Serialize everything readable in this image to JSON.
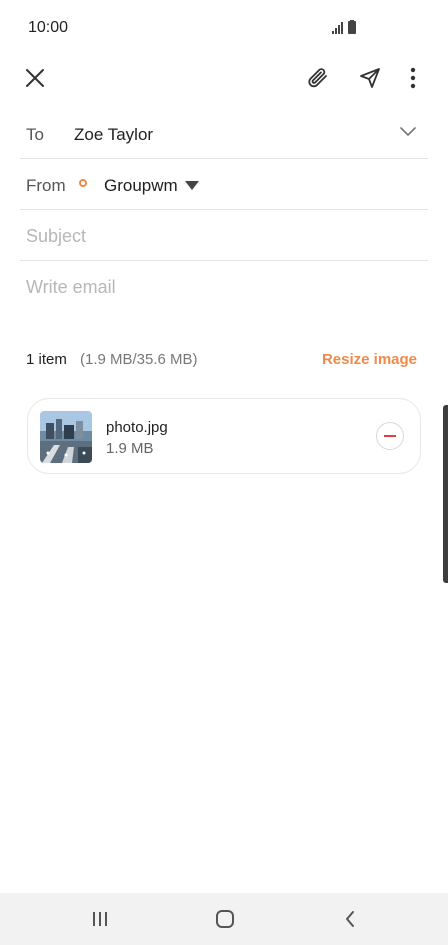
{
  "status_bar": {
    "time": "10:00",
    "icons": [
      "signal-icon",
      "battery-icon"
    ]
  },
  "toolbar": {
    "icons": [
      "close-icon",
      "attach-icon",
      "send-icon",
      "more-vertical-icon"
    ]
  },
  "compose": {
    "to_label": "To",
    "to_value": "Zoe Taylor",
    "from_label": "From",
    "from_value": "Groupwm",
    "subject_placeholder": "Subject",
    "body_placeholder": "Write email"
  },
  "attachments": {
    "summary": "1 item",
    "size_info": "(1.9 MB/35.6 MB)",
    "resize_label": "Resize image",
    "items": [
      {
        "name": "photo.jpg",
        "size": "1.9 MB"
      }
    ]
  },
  "nav_bar": {
    "icons": [
      "recent-apps-icon",
      "home-icon",
      "back-icon"
    ]
  },
  "colors": {
    "accent": "#f08a4b",
    "remove": "#e0413b",
    "placeholder": "#b7b7b7",
    "divider": "#e4e4e4"
  }
}
